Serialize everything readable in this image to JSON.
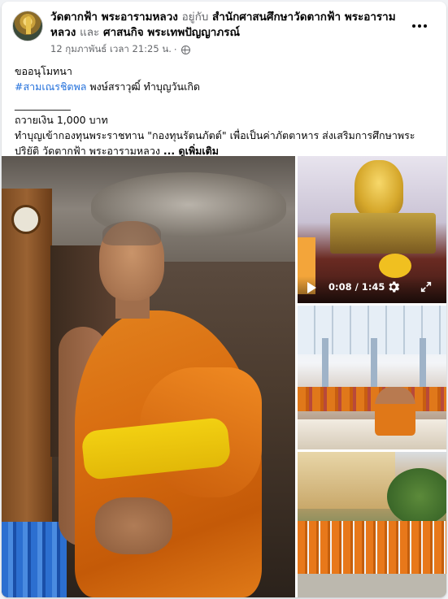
{
  "post": {
    "page_name": "วัดตากฟ้า พระอารามหลวง",
    "with_word": "อยู่กับ",
    "tagged_1": "สำนักศาสนศึกษาวัดตากฟ้า พระอาราม หลวง",
    "and_word": "และ",
    "tagged_2": "ศาสนกิจ พระเทพปัญญาภรณ์",
    "timestamp": "12 กุมภาพันธ์ เวลา 21:25 น.",
    "privacy_icon": "globe-icon",
    "more_icon": "more-horizontal-icon"
  },
  "content": {
    "line1": "ขออนุโมทนา",
    "hashtag": "#สามเณรชิตพล",
    "line2_rest": " พงษ์สราวุฒิ์ ทำบุญวันเกิด",
    "divider": "___________",
    "line3": "ถวายเงิน 1,000 บาท",
    "line4": "ทำบุญเข้ากองทุนพระราชทาน \"กองทุนรัตนภัตต์\" เพื่อเป็นค่าภัตตาหาร  ส่งเสริมการศึกษาพระ",
    "line5": "ปริยัติ วัดตากฟ้า พระอารามหลวง ",
    "see_more": "... ดูเพิ่มเติม"
  },
  "media": {
    "video": {
      "time": "0:08 / 1:45",
      "play_icon": "play-icon",
      "settings_icon": "gear-icon",
      "fullscreen_icon": "expand-icon"
    }
  },
  "colors": {
    "link": "#216fdb",
    "secondary_text": "#65676b",
    "primary_text": "#050505"
  }
}
